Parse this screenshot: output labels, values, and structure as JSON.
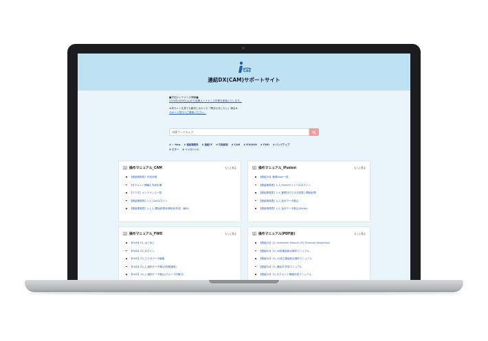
{
  "site": {
    "title": "連結DX(CAM)サポートサイト"
  },
  "notice": {
    "heading1": "■次回メンテナンス情報■",
    "line1": "2024年2月6日(火)から定期メンテナンス作業を実施いたします。",
    "heading2": "★本サイトを見ても解決しなかった「問合せをしたい」場合★",
    "line2": "サポート窓口へご連絡ください。"
  },
  "search": {
    "placeholder": "検索ワードを入力"
  },
  "tags": [
    "# ☆ New",
    "# 連結精算表",
    "# 連結CF",
    "# 内部統制",
    "# CAM",
    "# iFUSION",
    "# FWD",
    "# バックアップ",
    "# エラー",
    "# インストール"
  ],
  "cards": [
    {
      "title": "操作マニュアル_CAM",
      "more": "もっと見る",
      "items": [
        "【連結精算表】作成手順",
        "【セグメント情報】作成手順",
        "【マスタ】メンテナンス一覧",
        "【連結精算表】1-1_CAMログイン",
        "【連結精算表】1-1_1_開始処理(前期仕訳作成、締め)"
      ]
    },
    {
      "title": "操作マニュアル_iFusion",
      "more": "もっと見る",
      "items": [
        "【連結DX】登録Book一覧",
        "【連結精算表】1-3_Portalサイトへのログイン",
        "【連結精算表】1-4_管理日付マスタ変更と開始処理",
        "【連結精算表】2-1_会計データ取込",
        "【連結精算表】2-2_会計データ取込(Portal)"
      ]
    },
    {
      "title": "操作マニュアル_FWD",
      "more": "もっと見る",
      "items": [
        "【FWD】01_はじめに",
        "【FWD】02_ログイン",
        "【FWD】03_マスタデータ編集",
        "【FWD】04_1_個別データ取込(財務諸表)",
        "【FWD】04_2_個別データ取込(グループ内取引)"
      ]
    },
    {
      "title": "操作マニュアル(PDF版)",
      "more": "もっと見る",
      "items": [
        "【連結DX】02_Operation Manual (30_Financial_Reporting)",
        "【連結DX】10_00即連結時点操作マニュアル",
        "【連結DX】10_01設立連結時点操作マニュアル",
        "【連結DX】02_連結CF作成マニュアル",
        "【連結DX】70_セグメント情報作成マニュアル"
      ]
    }
  ],
  "colors": {
    "header": "#bfe2f3",
    "accent": "#f29b9b",
    "link": "#2a5db0"
  }
}
